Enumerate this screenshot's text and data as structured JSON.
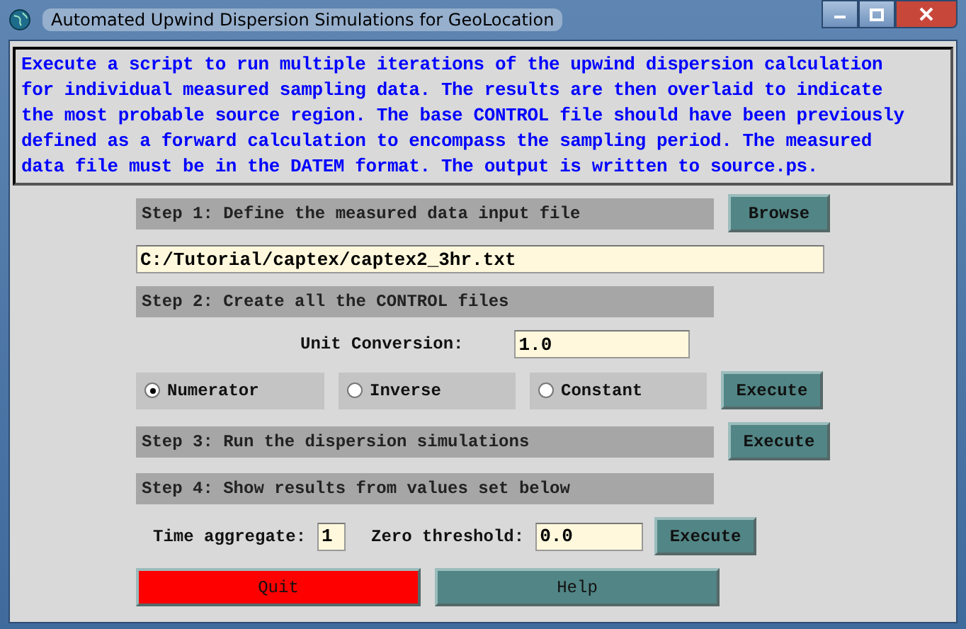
{
  "window": {
    "title": "Automated Upwind Dispersion Simulations for GeoLocation"
  },
  "description": "Execute a script to run multiple iterations of the upwind dispersion calculation\nfor individual measured sampling data. The results are then overlaid to indicate\nthe most probable source region. The base CONTROL file should have been previously\ndefined as a forward calculation to encompass the sampling period. The measured\ndata file must be in the DATEM format. The output is written to source.ps.",
  "step1": {
    "label": "Step 1: Define the measured data input file",
    "button": "Browse",
    "file": "C:/Tutorial/captex/captex2_3hr.txt"
  },
  "step2": {
    "label": "Step 2: Create all the CONTROL files",
    "unit_label": "Unit Conversion:",
    "unit_value": "1.0",
    "options": [
      {
        "label": "Numerator",
        "selected": true
      },
      {
        "label": "Inverse",
        "selected": false
      },
      {
        "label": "Constant",
        "selected": false
      }
    ],
    "button": "Execute"
  },
  "step3": {
    "label": "Step 3: Run the dispersion simulations",
    "button": "Execute"
  },
  "step4": {
    "label": "Step 4: Show results from values set below",
    "time_label": "Time aggregate:",
    "time_value": "1",
    "zero_label": "Zero threshold:",
    "zero_value": "0.0",
    "button": "Execute"
  },
  "footer": [
    {
      "label": "Quit",
      "kind": "danger"
    },
    {
      "label": "Help",
      "kind": "normal"
    }
  ]
}
